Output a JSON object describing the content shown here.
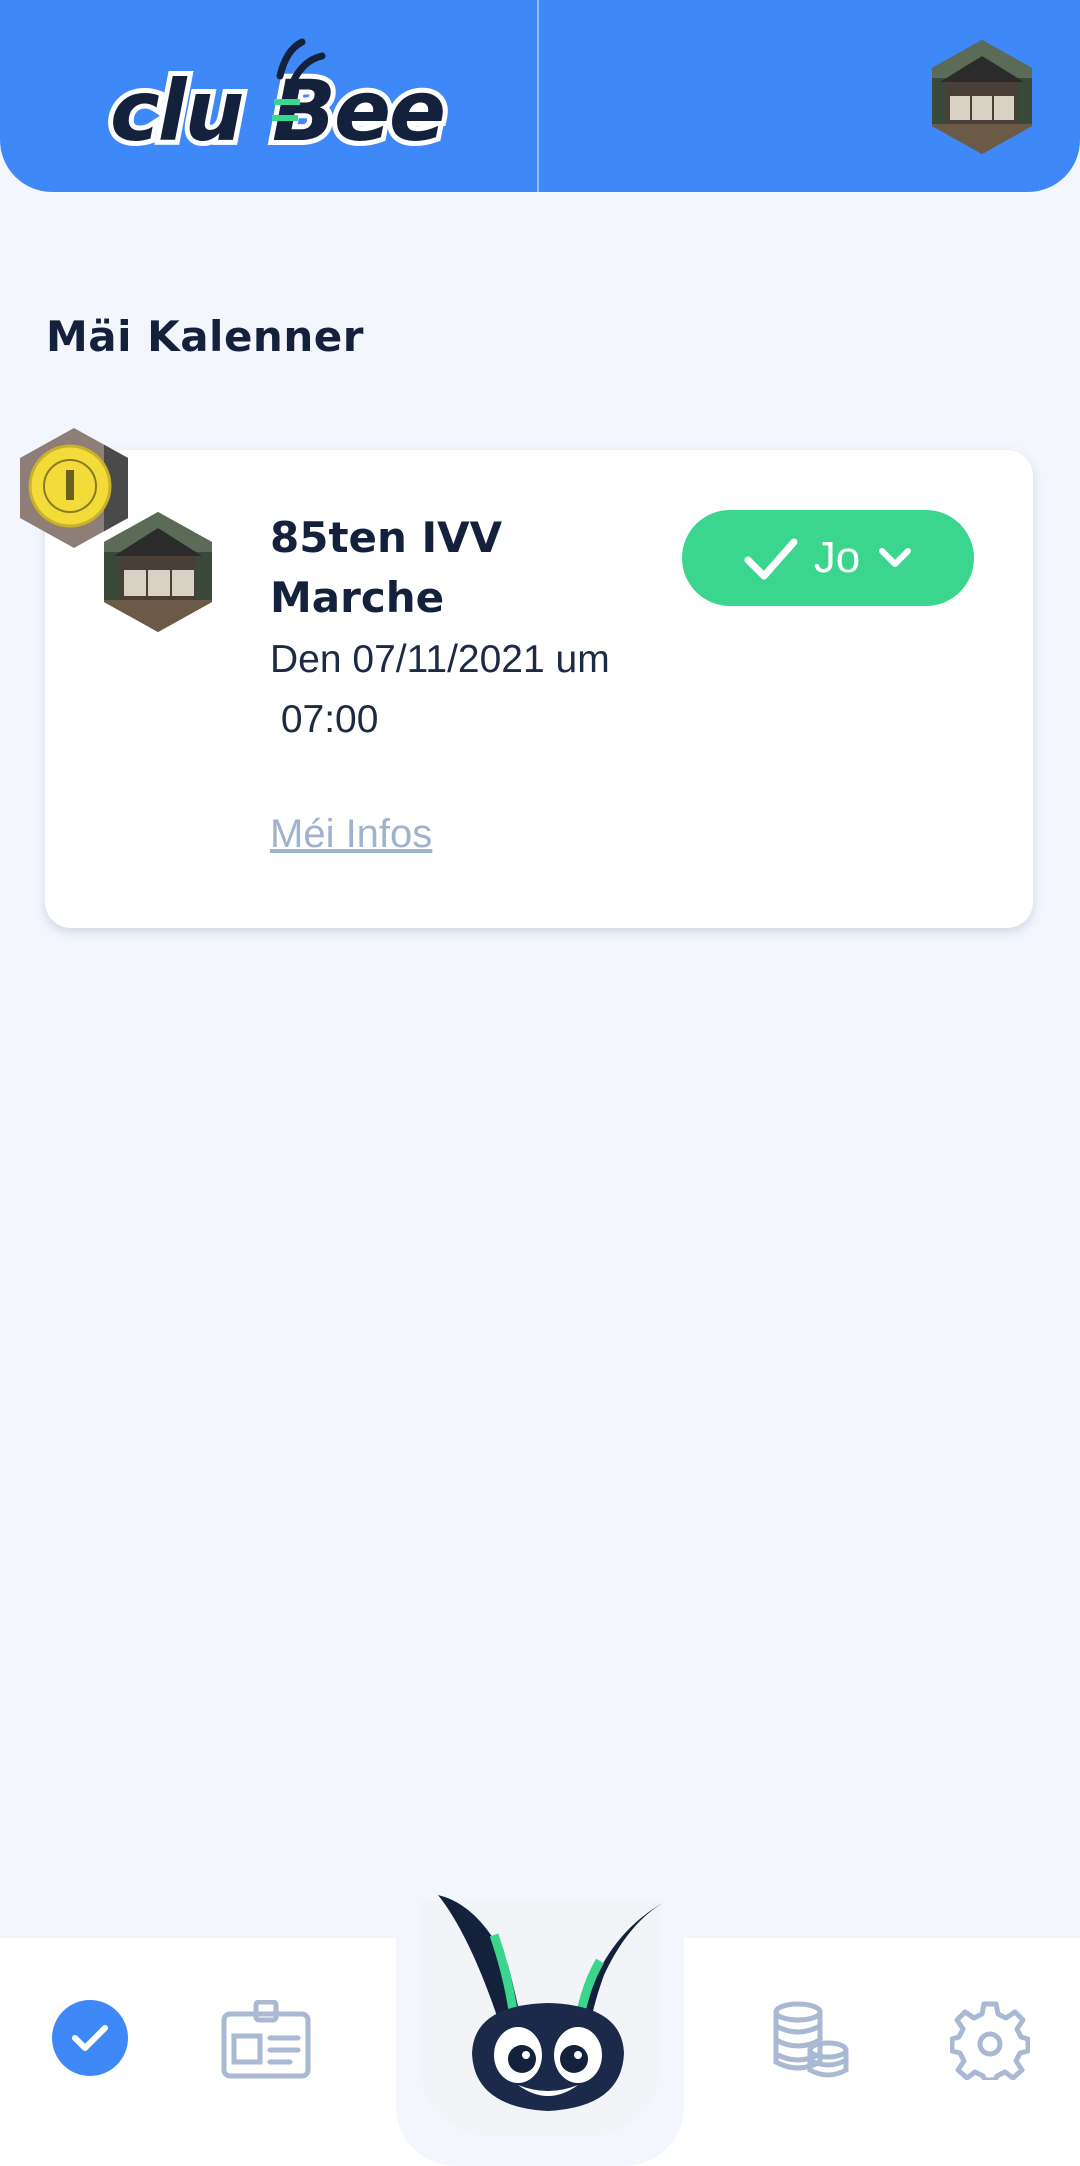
{
  "header": {
    "logo_text": "cluBee",
    "colors": {
      "background": "#3f88f7"
    }
  },
  "page": {
    "title": "Mäi Kalenner"
  },
  "event": {
    "title": "85ten IVV Marche",
    "date_text": "Den 07/11/2021 um\n 07:00",
    "more_info": "Méi Infos",
    "rsvp_label": "Jo",
    "rsvp_color": "#3bd68d"
  },
  "nav": {
    "items": [
      {
        "icon": "check-circle-icon",
        "active": true
      },
      {
        "icon": "id-card-icon",
        "active": false
      },
      {
        "icon": "bee-mascot-icon",
        "active": false
      },
      {
        "icon": "coins-icon",
        "active": false
      },
      {
        "icon": "gear-icon",
        "active": false
      }
    ],
    "colors": {
      "active": "#3f88f7",
      "inactive": "#a9b9d3"
    }
  }
}
